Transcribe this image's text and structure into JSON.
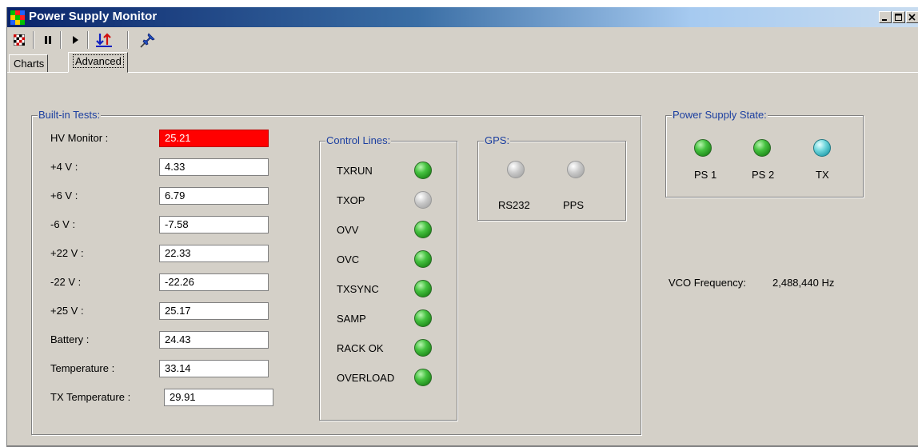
{
  "window": {
    "title": "Power Supply Monitor",
    "controls": [
      "minimize",
      "maximize",
      "close"
    ]
  },
  "toolbar": {
    "buttons": [
      {
        "icon": "checkered-flag-icon"
      },
      {
        "icon": "pause-icon"
      },
      {
        "icon": "play-icon"
      },
      {
        "icon": "sort-arrows-icon"
      },
      {
        "icon": "pushpin-icon"
      }
    ]
  },
  "tabs": [
    {
      "label": "Charts",
      "active": false
    },
    {
      "label": "Advanced",
      "active": true
    }
  ],
  "builtin_tests": {
    "title": "Built-in Tests:",
    "rows": [
      {
        "label": "HV Monitor :",
        "value": "25.21",
        "alarm": true
      },
      {
        "label": "+4 V :",
        "value": "4.33",
        "alarm": false
      },
      {
        "label": "+6 V :",
        "value": "6.79",
        "alarm": false
      },
      {
        "label": "-6 V :",
        "value": "-7.58",
        "alarm": false
      },
      {
        "label": "+22 V :",
        "value": "22.33",
        "alarm": false
      },
      {
        "label": "-22 V :",
        "value": "-22.26",
        "alarm": false
      },
      {
        "label": "+25 V :",
        "value": "25.17",
        "alarm": false
      },
      {
        "label": "Battery :",
        "value": "24.43",
        "alarm": false
      },
      {
        "label": "Temperature :",
        "value": "33.14",
        "alarm": false
      },
      {
        "label": "TX Temperature :",
        "value": "29.91",
        "alarm": false
      }
    ],
    "alarm_color": "#ff0000"
  },
  "control_lines": {
    "title": "Control Lines:",
    "items": [
      {
        "label": "TXRUN",
        "state": "green"
      },
      {
        "label": "TXOP",
        "state": "gray"
      },
      {
        "label": "OVV",
        "state": "green"
      },
      {
        "label": "OVC",
        "state": "green"
      },
      {
        "label": "TXSYNC",
        "state": "green"
      },
      {
        "label": "SAMP",
        "state": "green"
      },
      {
        "label": "RACK OK",
        "state": "green"
      },
      {
        "label": "OVERLOAD",
        "state": "green"
      }
    ]
  },
  "gps": {
    "title": "GPS:",
    "items": [
      {
        "label": "RS232",
        "state": "gray"
      },
      {
        "label": "PPS",
        "state": "gray"
      }
    ]
  },
  "power_supply_state": {
    "title": "Power Supply State:",
    "items": [
      {
        "label": "PS 1",
        "state": "green"
      },
      {
        "label": "PS 2",
        "state": "green"
      },
      {
        "label": "TX",
        "state": "cyan"
      }
    ]
  },
  "vco": {
    "label": "VCO Frequency:",
    "value": "2,488,440 Hz"
  },
  "colors": {
    "titlebar_start": "#0a246a",
    "titlebar_end": "#a6caf0",
    "window_bg": "#d4d0c8",
    "group_title": "#1c3fa0",
    "led_green": "#45c240",
    "led_gray": "#c8c8c8",
    "led_cyan": "#6fd6dc"
  }
}
